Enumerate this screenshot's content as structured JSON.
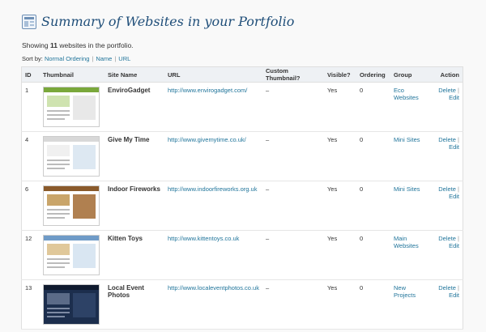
{
  "page": {
    "title": "Summary of Websites in your Portfolio",
    "showing_prefix": "Showing",
    "showing_count": "11",
    "showing_suffix": "websites in the portfolio.",
    "sort_label": "Sort by:",
    "sort_options": [
      "Normal Ordering",
      "Name",
      "URL"
    ]
  },
  "table": {
    "headers": [
      "ID",
      "Thumbnail",
      "Site Name",
      "URL",
      "Custom Thumbnail?",
      "Visible?",
      "Ordering",
      "Group",
      "Action"
    ],
    "rows": [
      {
        "id": "1",
        "name": "EnviroGadget",
        "url": "http://www.envirogadget.com/",
        "custom": "–",
        "visible": "Yes",
        "ordering": "0",
        "group": "Eco Websites",
        "delete": "Delete",
        "edit": "Edit",
        "thumb_color": "#7aa83b"
      },
      {
        "id": "4",
        "name": "Give My Time",
        "url": "http://www.givemytime.co.uk/",
        "custom": "–",
        "visible": "Yes",
        "ordering": "0",
        "group": "Mini Sites",
        "delete": "Delete",
        "edit": "Edit",
        "thumb_color": "#d8d8d8"
      },
      {
        "id": "6",
        "name": "Indoor Fireworks",
        "url": "http://www.indoorfireworks.org.uk",
        "custom": "–",
        "visible": "Yes",
        "ordering": "0",
        "group": "Mini Sites",
        "delete": "Delete",
        "edit": "Edit",
        "thumb_color": "#8a5a2b"
      },
      {
        "id": "12",
        "name": "Kitten Toys",
        "url": "http://www.kittentoys.co.uk",
        "custom": "–",
        "visible": "Yes",
        "ordering": "0",
        "group": "Main Websites",
        "delete": "Delete",
        "edit": "Edit",
        "thumb_color": "#6f9bc7"
      },
      {
        "id": "13",
        "name": "Local Event Photos",
        "url": "http://www.localeventphotos.co.uk",
        "custom": "–",
        "visible": "Yes",
        "ordering": "0",
        "group": "New Projects",
        "delete": "Delete",
        "edit": "Edit",
        "thumb_color": "#1c2e4d"
      }
    ]
  },
  "icons": {
    "header": "portfolio-icon"
  },
  "colors": {
    "link": "#21759b",
    "title": "#1f4e79",
    "header_bg": "#eef1f4"
  }
}
